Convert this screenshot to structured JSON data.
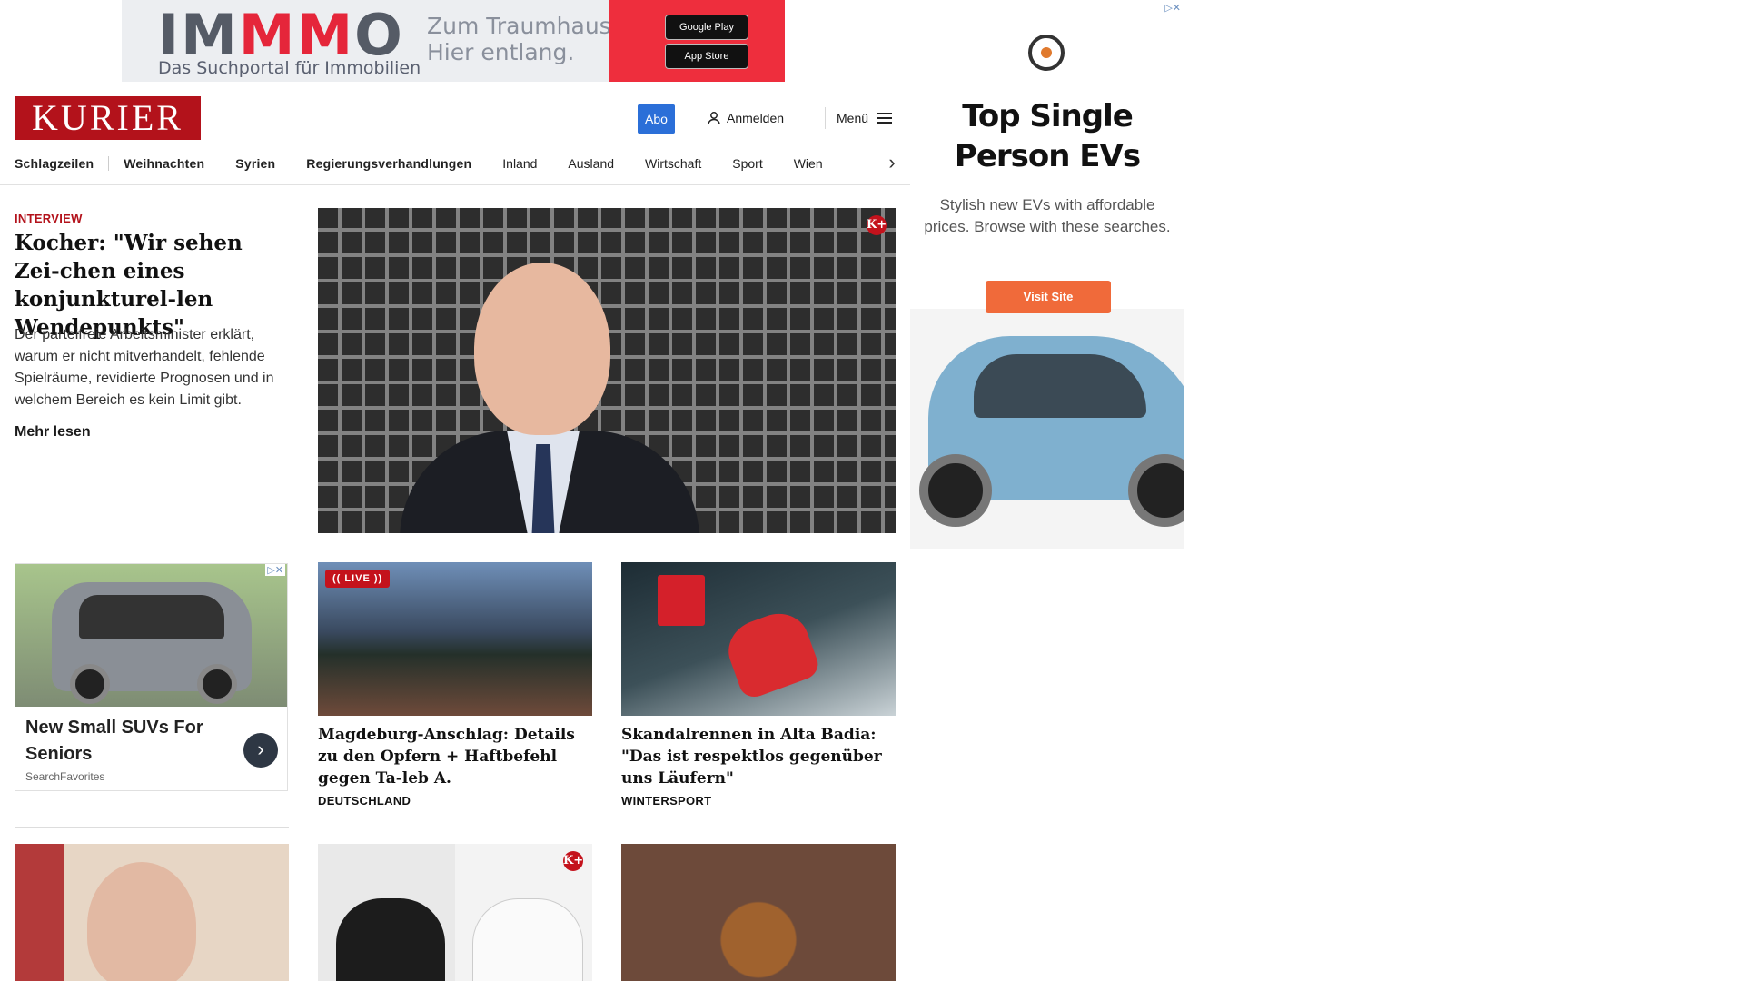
{
  "top_ad": {
    "brand_prefix": "IM",
    "brand_highlight": "MM",
    "brand_suffix": "O",
    "tagline": "Das Suchportal für Immobilien",
    "claim_line1": "Zum Traumhaus?",
    "claim_line2": "Hier entlang.",
    "google_play": "Google Play",
    "app_store": "App Store"
  },
  "header": {
    "logo": "KURIER",
    "abo_label": "Abo",
    "login_label": "Anmelden",
    "menu_label": "Menü"
  },
  "nav": {
    "items": [
      "Schlagzeilen",
      "Weihnachten",
      "Syrien",
      "Regierungsverhandlungen",
      "Inland",
      "Ausland",
      "Wirtschaft",
      "Sport",
      "Wien"
    ]
  },
  "lead": {
    "kicker": "INTERVIEW",
    "title": "Kocher: \"Wir sehen Zei-chen eines konjunkturel-len Wendepunkts\"",
    "teaser": "Der parteifreie Arbeitsminister erklärt, warum er nicht mitverhandelt, fehlende Spielräume, revidierte Prognosen und in welchem Bereich es kein Limit gibt.",
    "more": "Mehr lesen",
    "badge": "K+"
  },
  "side_ad": {
    "adchoice": "▷✕",
    "headline": "Top Single Person EVs",
    "body": "Stylish new EVs with affordable prices. Browse with these searches.",
    "cta": "Visit Site"
  },
  "ad_card": {
    "title": "New Small SUVs For Seniors",
    "source": "SearchFavorites",
    "adchoice": "▷✕"
  },
  "cards": [
    {
      "live": "(( LIVE ))",
      "title": "Magdeburg-Anschlag: Details zu den Opfern + Haftbefehl gegen Ta-leb A.",
      "category": "DEUTSCHLAND"
    },
    {
      "title": "Skandalrennen in Alta Badia: \"Das ist respektlos gegenüber uns Läufern\"",
      "category": "WINTERSPORT"
    }
  ],
  "row3": {
    "badge": "K+"
  },
  "colors": {
    "brand_red": "#b3121b",
    "abo_blue": "#2b6fd8",
    "ad_orange": "#f06a3a"
  }
}
